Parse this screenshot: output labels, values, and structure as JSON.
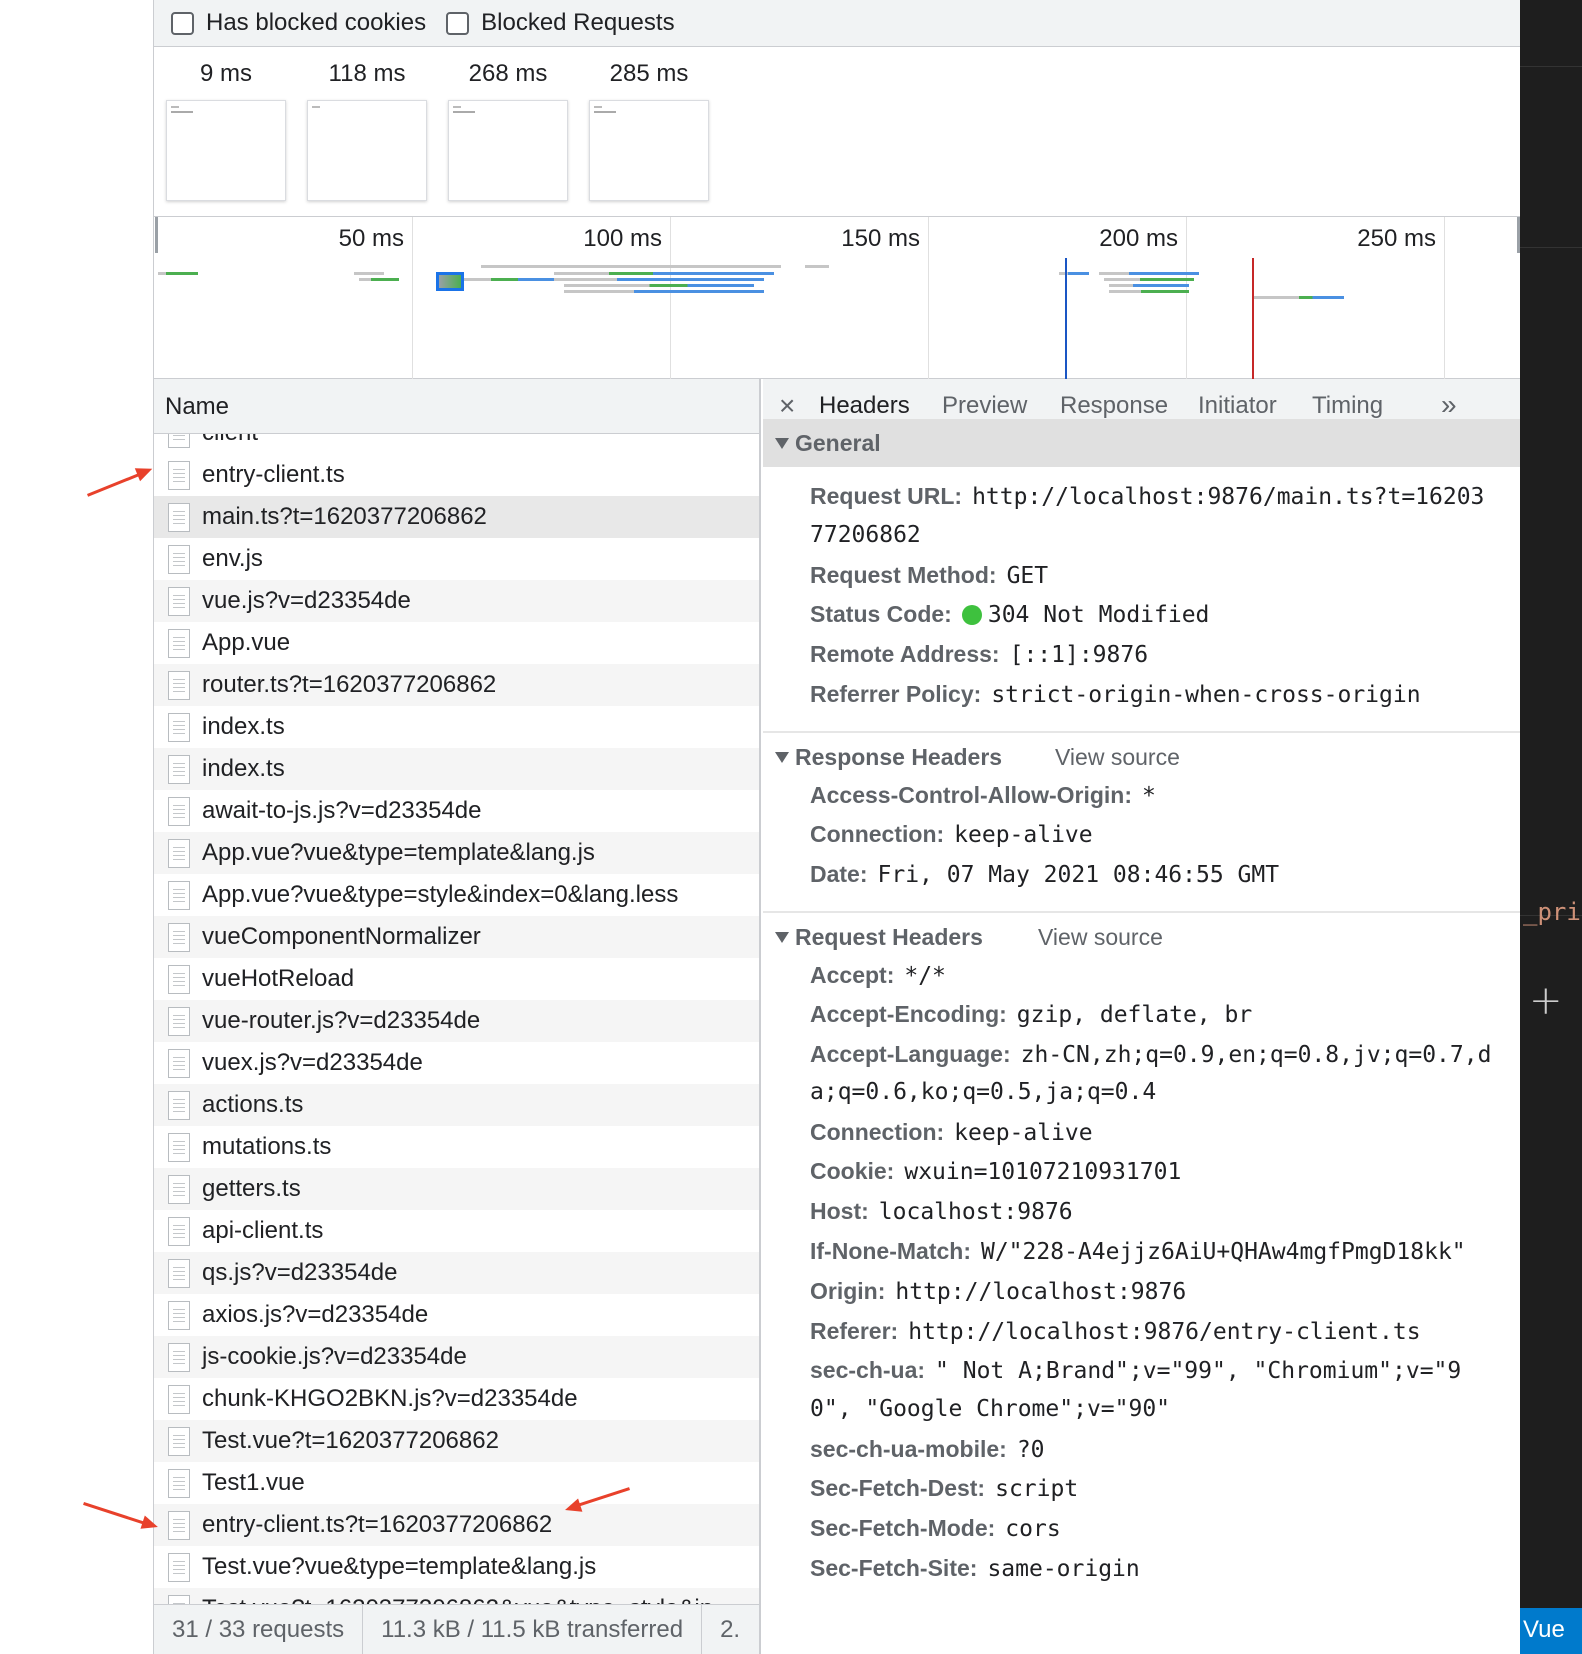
{
  "filter_bar": {
    "has_blocked_cookies": "Has blocked cookies",
    "blocked_requests": "Blocked Requests"
  },
  "screenshots": [
    "9 ms",
    "118 ms",
    "268 ms",
    "285 ms"
  ],
  "overview": {
    "labels": [
      "50 ms",
      "100 ms",
      "150 ms",
      "200 ms",
      "250 ms"
    ],
    "colors": {
      "waiting": "#c6c6c6",
      "download": "#4a90e2",
      "ttfb": "#4caf50",
      "dom_line": "#1a56c4",
      "load_line": "#c62828"
    }
  },
  "name_column": {
    "header": "Name",
    "clipped_top": "client",
    "rows": [
      "entry-client.ts",
      "main.ts?t=1620377206862",
      "env.js",
      "vue.js?v=d23354de",
      "App.vue",
      "router.ts?t=1620377206862",
      "index.ts",
      "index.ts",
      "await-to-js.js?v=d23354de",
      "App.vue?vue&type=template&lang.js",
      "App.vue?vue&type=style&index=0&lang.less",
      "vueComponentNormalizer",
      "vueHotReload",
      "vue-router.js?v=d23354de",
      "vuex.js?v=d23354de",
      "actions.ts",
      "mutations.ts",
      "getters.ts",
      "api-client.ts",
      "qs.js?v=d23354de",
      "axios.js?v=d23354de",
      "js-cookie.js?v=d23354de",
      "chunk-KHGO2BKN.js?v=d23354de",
      "Test.vue?t=1620377206862",
      "Test1.vue",
      "entry-client.ts?t=1620377206862",
      "Test.vue?vue&type=template&lang.js",
      "Test.vue?t=1620377206862&vue&type=style&in"
    ]
  },
  "status_bar": {
    "requests": "31 / 33 requests",
    "transferred": "11.3 kB / 11.5 kB transferred",
    "resources": "2."
  },
  "details": {
    "tabs": [
      "Headers",
      "Preview",
      "Response",
      "Initiator",
      "Timing"
    ],
    "more_tabs": "»",
    "close": "×",
    "general": {
      "title": "General",
      "request_url_k": "Request URL:",
      "request_url_v": "http://localhost:9876/main.ts?t=16203",
      "request_url_cont": "77206862",
      "method_k": "Request Method:",
      "method_v": "GET",
      "status_k": "Status Code:",
      "status_v": "304 Not Modified",
      "remote_k": "Remote Address:",
      "remote_v": "[::1]:9876",
      "referrer_policy_k": "Referrer Policy:",
      "referrer_policy_v": "strict-origin-when-cross-origin"
    },
    "response_headers": {
      "title": "Response Headers",
      "view_source": "View source",
      "acao_k": "Access-Control-Allow-Origin:",
      "acao_v": "*",
      "connection_k": "Connection:",
      "connection_v": "keep-alive",
      "date_k": "Date:",
      "date_v": "Fri, 07 May 2021 08:46:55 GMT"
    },
    "request_headers": {
      "title": "Request Headers",
      "view_source": "View source",
      "accept_k": "Accept:",
      "accept_v": "*/*",
      "encoding_k": "Accept-Encoding:",
      "encoding_v": "gzip, deflate, br",
      "language_k": "Accept-Language:",
      "language_v": "zh-CN,zh;q=0.9,en;q=0.8,jv;q=0.7,d",
      "language_cont": "a;q=0.6,ko;q=0.5,ja;q=0.4",
      "connection_k": "Connection:",
      "connection_v": "keep-alive",
      "cookie_k": "Cookie:",
      "cookie_v": "wxuin=10107210931701",
      "host_k": "Host:",
      "host_v": "localhost:9876",
      "inm_k": "If-None-Match:",
      "inm_v": "W/\"228-A4ejjz6AiU+QHAw4mgfPmgD18kk\"",
      "origin_k": "Origin:",
      "origin_v": "http://localhost:9876",
      "referer_k": "Referer:",
      "referer_v": "http://localhost:9876/entry-client.ts",
      "secua_k": "sec-ch-ua:",
      "secua_v": "\" Not A;Brand\";v=\"99\", \"Chromium\";v=\"9",
      "secua_cont": "0\", \"Google Chrome\";v=\"90\"",
      "mobile_k": "sec-ch-ua-mobile:",
      "mobile_v": "?0",
      "dest_k": "Sec-Fetch-Dest:",
      "dest_v": "script",
      "mode_k": "Sec-Fetch-Mode:",
      "mode_v": "cors",
      "site_k": "Sec-Fetch-Site:",
      "site_v": "same-origin"
    }
  },
  "editor_strip": {
    "code_fragment": "_pri",
    "plus": "+",
    "status_label": "Vue"
  }
}
